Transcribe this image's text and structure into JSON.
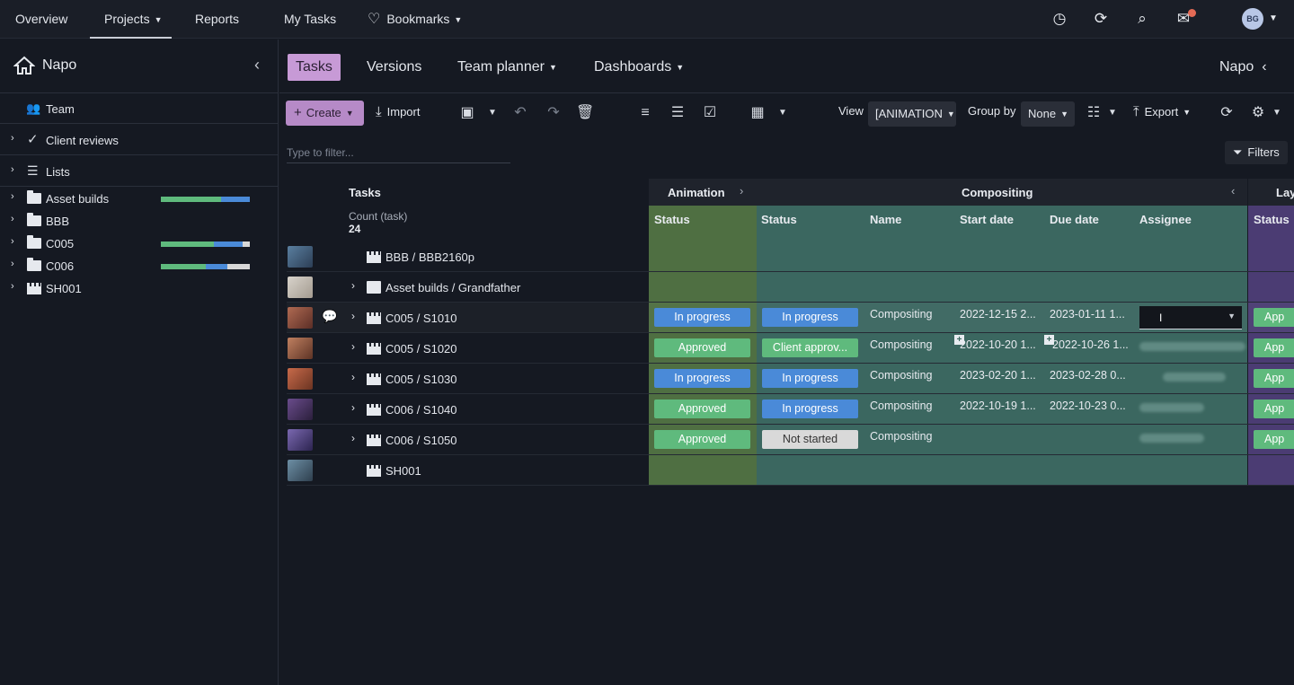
{
  "topnav": {
    "overview": "Overview",
    "projects": "Projects",
    "reports": "Reports",
    "my_tasks": "My Tasks",
    "bookmarks": "Bookmarks",
    "avatar_initials": "BG"
  },
  "sidebar": {
    "project_title": "Napo",
    "team_label": "Team",
    "client_reviews_label": "Client reviews",
    "lists_label": "Lists",
    "tree": [
      {
        "label": "Asset builds",
        "progress": [
          0.68,
          0.32,
          0.0
        ]
      },
      {
        "label": "BBB"
      },
      {
        "label": "C005",
        "progress": [
          0.6,
          0.32,
          0.08
        ]
      },
      {
        "label": "C006",
        "progress": [
          0.5,
          0.25,
          0.25
        ]
      },
      {
        "label": "SH001"
      }
    ]
  },
  "tabs": {
    "tasks": "Tasks",
    "versions": "Versions",
    "team_planner": "Team planner",
    "dashboards": "Dashboards",
    "project_switch": "Napo"
  },
  "toolbar": {
    "create": "Create",
    "import": "Import",
    "view_label": "View",
    "view_value": "[ANIMATION",
    "group_by_label": "Group by",
    "group_by_value": "None",
    "export": "Export"
  },
  "filter": {
    "placeholder": "Type to filter...",
    "filters_button": "Filters"
  },
  "grid": {
    "tasks_header": "Tasks",
    "count_label": "Count (task)",
    "count_value": "24",
    "group_animation": "Animation",
    "group_compositing": "Compositing",
    "group_layout": "Lay",
    "col_anim_status": "Status",
    "col_comp_status": "Status",
    "col_name": "Name",
    "col_start": "Start date",
    "col_due": "Due date",
    "col_assignee": "Assignee",
    "col_lay_status": "Status",
    "rows": [
      {
        "label": "BBB / BBB2160p"
      },
      {
        "label": "Asset builds / Grandfather"
      },
      {
        "label": "C005 / S1010",
        "anim": "In progress",
        "comp": "In progress",
        "name": "Compositing",
        "start": "2022-12-15 2...",
        "due": "2023-01-11 1...",
        "lay": "App"
      },
      {
        "label": "C005 / S1020",
        "anim": "Approved",
        "comp": "Client approv...",
        "name": "Compositing",
        "start": "2022-10-20 1...",
        "due": "2022-10-26 1...",
        "lay": "App"
      },
      {
        "label": "C005 / S1030",
        "anim": "In progress",
        "comp": "In progress",
        "name": "Compositing",
        "start": "2023-02-20 1...",
        "due": "2023-02-28 0...",
        "lay": "App"
      },
      {
        "label": "C006 / S1040",
        "anim": "Approved",
        "comp": "In progress",
        "name": "Compositing",
        "start": "2022-10-19 1...",
        "due": "2022-10-23 0...",
        "lay": "App"
      },
      {
        "label": "C006 / S1050",
        "anim": "Approved",
        "comp": "Not started",
        "name": "Compositing",
        "lay": "App"
      },
      {
        "label": "SH001"
      }
    ]
  },
  "colors": {
    "accent": "#c79ad6",
    "status_blue": "#4a8ad8",
    "status_green": "#5fba7d",
    "animation_band": "#4f6f42",
    "compositing_band": "#3b6760",
    "layout_band": "#4b3c73"
  }
}
